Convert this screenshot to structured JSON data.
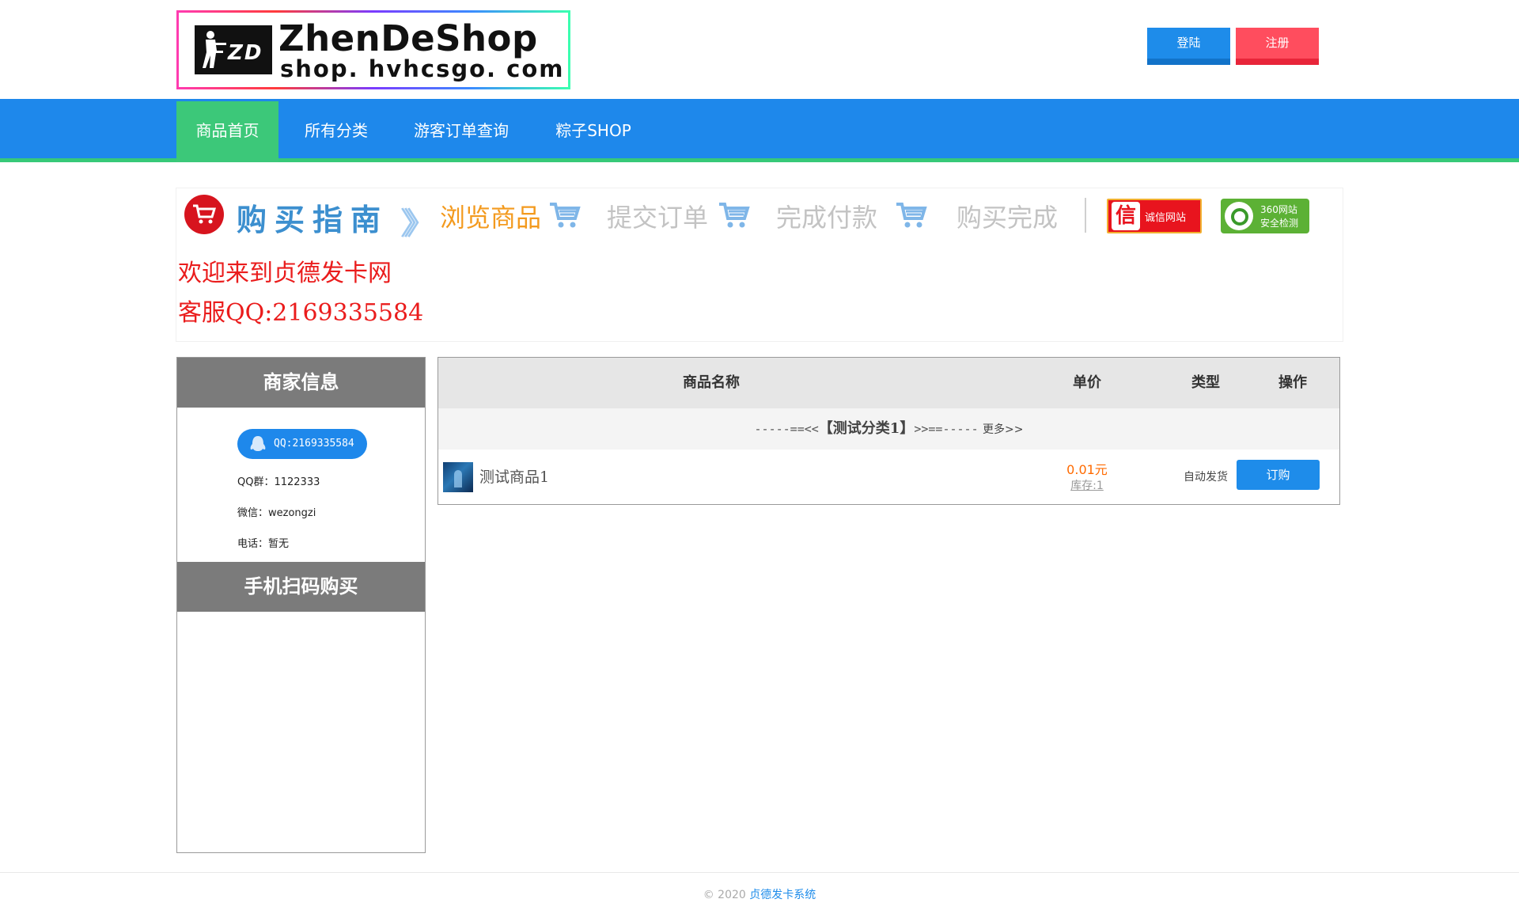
{
  "logo": {
    "icon_text": "ZD",
    "title": "ZhenDeShop",
    "subtitle": "shop. hvhcsgo. com"
  },
  "header": {
    "login_label": "登陆",
    "register_label": "注册"
  },
  "nav": {
    "items": [
      "商品首页",
      "所有分类",
      "游客订单查询",
      "粽子SHOP"
    ],
    "active": 0
  },
  "guide": {
    "title": "购买指南",
    "steps": [
      "浏览商品",
      "提交订单",
      "完成付款",
      "购买完成"
    ],
    "badge_chengxin": {
      "mark": "信",
      "text": "诚信网站"
    },
    "badge_360": {
      "line1": "360网站",
      "line2": "安全检测"
    }
  },
  "welcome": {
    "line1": "欢迎来到贞德发卡网",
    "line2": "客服QQ:2169335584"
  },
  "merchant": {
    "heading": "商家信息",
    "qq_button": "QQ:2169335584",
    "qq_group": "QQ群：1122333",
    "wechat": "微信：wezongzi",
    "phone": "电话：暂无",
    "scan_heading": "手机扫码购买"
  },
  "table": {
    "headers": [
      "商品名称",
      "单价",
      "类型",
      "操作"
    ],
    "category": {
      "prefix": "-----==<<",
      "name": "【测试分类1】",
      "suffix": ">>==-----",
      "more": "更多>>"
    },
    "rows": [
      {
        "name": "测试商品1",
        "price": "0.01元",
        "stock": "库存:1",
        "type": "自动发货",
        "action": "订购"
      }
    ]
  },
  "footer": {
    "copyright": "© 2020",
    "brand": "贞德发卡系统"
  },
  "colors": {
    "nav_blue": "#1e88eb",
    "nav_active_green": "#3cc879",
    "register_red": "#ff4d5e",
    "price_orange": "#ff6a00",
    "welcome_red": "#ea1c1c"
  }
}
